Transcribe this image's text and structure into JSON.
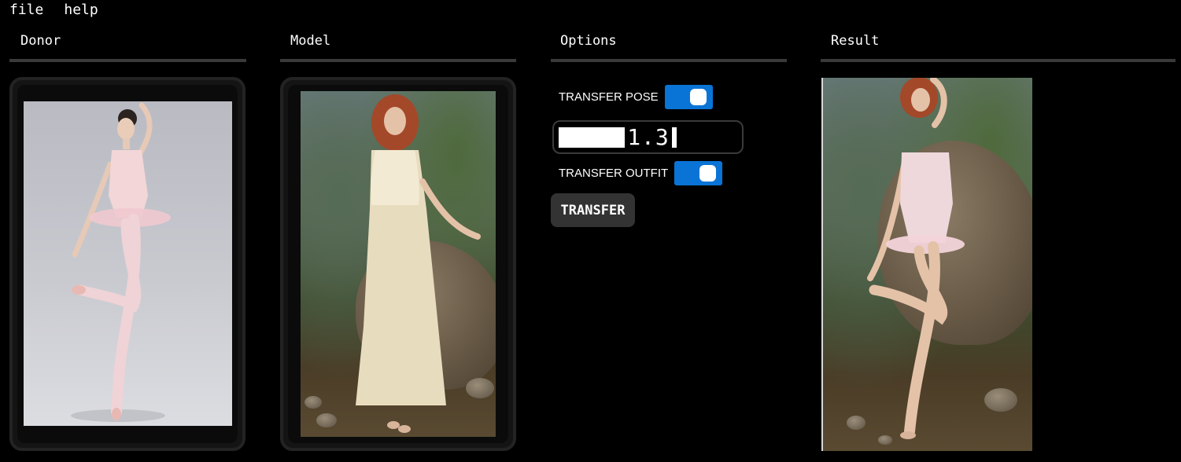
{
  "menu": {
    "file": "file",
    "help": "help"
  },
  "columns": {
    "donor": "Donor",
    "model": "Model",
    "options": "Options",
    "result": "Result"
  },
  "options": {
    "transfer_pose_label": "TRANSFER POSE",
    "transfer_pose_on": true,
    "strength_value": "1.3",
    "transfer_outfit_label": "TRANSFER OUTFIT",
    "transfer_outfit_on": true,
    "transfer_button": "TRANSFER"
  },
  "colors": {
    "background": "#000000",
    "toggle_on": "#0a74d6",
    "rule": "#3a3a3a",
    "button_bg": "#333333"
  }
}
